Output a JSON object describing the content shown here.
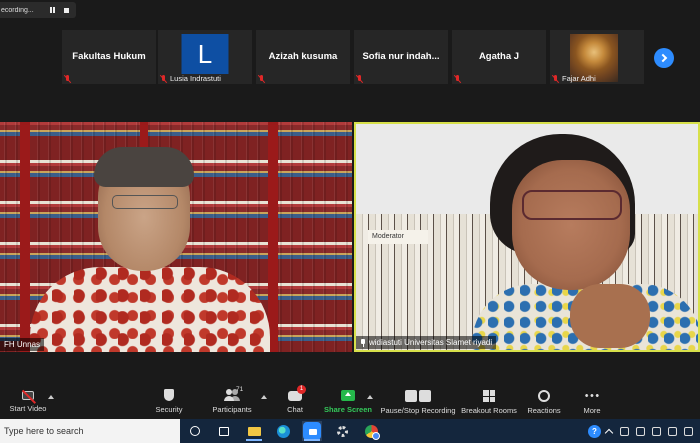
{
  "recording": {
    "label": "ecording..."
  },
  "gallery": [
    {
      "name": "Fakultas Hukum",
      "footer": "",
      "type": "name"
    },
    {
      "name": "",
      "footer": "Lusia Indrastuti",
      "type": "avatar",
      "avatar_letter": "L"
    },
    {
      "name": "Azizah kusuma",
      "footer": "",
      "type": "name"
    },
    {
      "name": "Sofia  nur  indah...",
      "footer": "",
      "type": "name"
    },
    {
      "name": "Agatha J",
      "footer": "",
      "type": "name"
    },
    {
      "name": "",
      "footer": "Fajar Adhi",
      "type": "image"
    }
  ],
  "main_video": {
    "left": {
      "name_tag": "FH Unnas"
    },
    "right": {
      "name_tag": "widiastuti Universitas Slamet riyadi",
      "sign": "Moderator"
    }
  },
  "toolbar": {
    "start_video": "Start Video",
    "security": "Security",
    "participants": "Participants",
    "participant_count": "71",
    "chat": "Chat",
    "chat_badge": "1",
    "share_screen": "Share Screen",
    "pause_stop": "Pause/Stop Recording",
    "breakout": "Breakout Rooms",
    "reactions": "Reactions",
    "more": "More"
  },
  "taskbar": {
    "search_placeholder": "Type here to search"
  },
  "colors": {
    "accent": "#2d8cff",
    "share_green": "#25b84b",
    "muted_red": "#e02828",
    "active_speaker": "#d7e04a"
  }
}
